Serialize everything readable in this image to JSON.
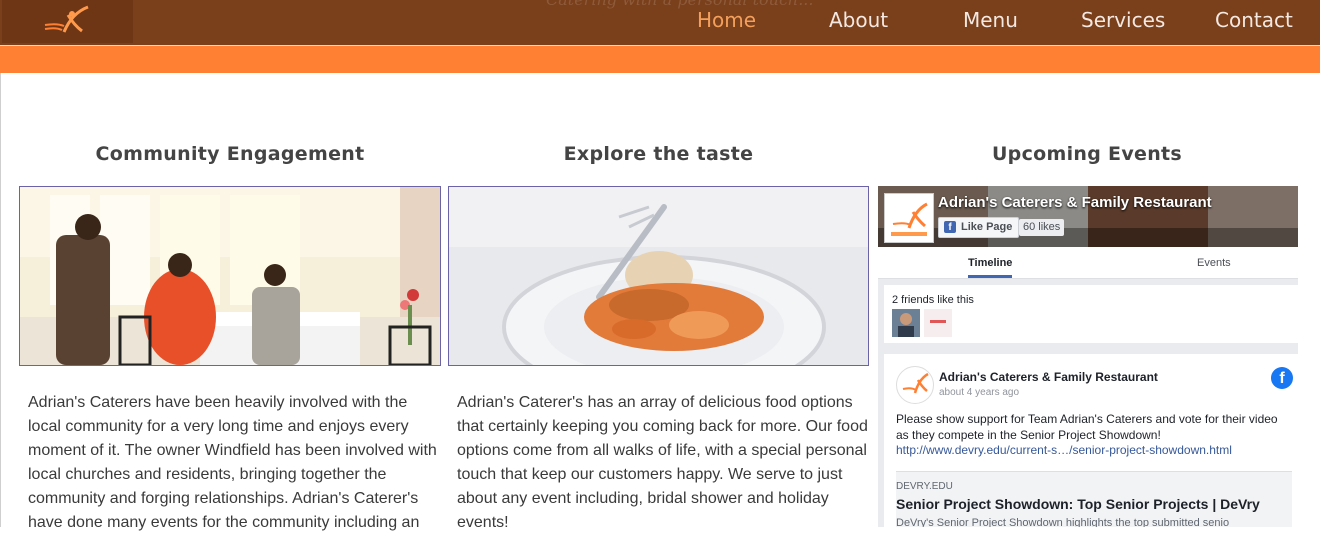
{
  "header": {
    "tagline": "Catering with a personal touch...",
    "nav": [
      "Home",
      "About",
      "Menu",
      "Services",
      "Contact"
    ],
    "active_index": 0
  },
  "columns": [
    {
      "title": "Community Engagement",
      "image_alt": "Guests dining at a restaurant table",
      "text": "Adrian's Caterers have been heavily involved with the local community for a very long time and enjoys every moment of it. The owner Windfield has been involved with local churches and residents, bringing together the community and forging relationships. Adrian's Caterer's have done many events for the community including an"
    },
    {
      "title": "Explore the taste",
      "image_alt": "Peach cobbler dessert on a glass plate",
      "text": "Adrian's Caterer's has an array of delicious food options that certainly keeping you coming back for more. Our food options come from all walks of life, with a special personal touch that keep our customers happy. We serve to just about any event including, bridal shower and holiday events!"
    },
    {
      "title": "Upcoming Events"
    }
  ],
  "facebook": {
    "page_name": "Adrian's Caterers & Family Restaurant",
    "like_label": "Like Page",
    "likes": "60 likes",
    "tabs": [
      "Timeline",
      "Events"
    ],
    "friends_text": "2 friends like this",
    "post": {
      "author": "Adrian's Caterers & Family Restaurant",
      "time": "about 4 years ago",
      "text": "Please show support for Team Adrian's Caterers and vote for their video as they compete in the Senior Project Showdown!",
      "link": "http://www.devry.edu/current-s…/senior-project-showdown.html",
      "card_domain": "DEVRY.EDU",
      "card_title": "Senior Project Showdown: Top Senior Projects | DeVry",
      "card_desc": "DeVry's Senior Project Showdown highlights the top submitted senio"
    }
  },
  "colors": {
    "header_bg": "#7a3f1b",
    "accent_orange": "#ff7f33",
    "nav_active": "#f4a05c",
    "facebook_blue": "#4267b2"
  }
}
